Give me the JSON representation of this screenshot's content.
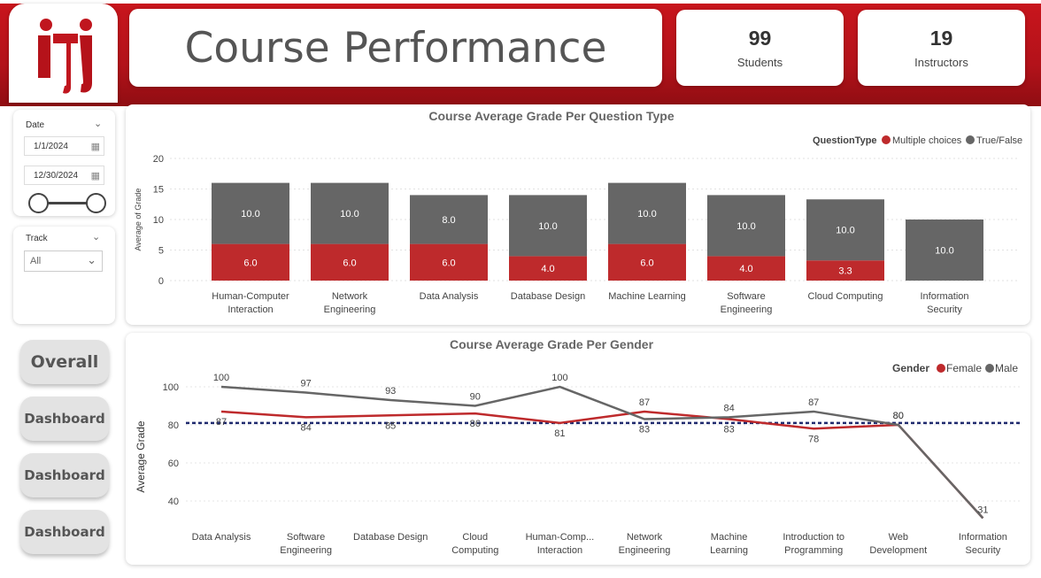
{
  "header": {
    "title": "Course Performance",
    "kpis": [
      {
        "value": "99",
        "label": "Students"
      },
      {
        "value": "19",
        "label": "Instructors"
      }
    ]
  },
  "filters": {
    "date_label": "Date",
    "start_date": "1/1/2024",
    "end_date": "12/30/2024",
    "track_label": "Track",
    "track_value": "All"
  },
  "nav": {
    "buttons": [
      "Overall",
      "Dashboard",
      "Dashboard",
      "Dashboard"
    ]
  },
  "colors": {
    "brand_red": "#c0161e",
    "bar_red": "#be2a2c",
    "bar_gray": "#666666",
    "avg_line": "#1f2a6e"
  },
  "chart_data": [
    {
      "type": "bar",
      "stacked": true,
      "title": "Course Average Grade Per Question Type",
      "ylabel": "Average of Grade",
      "xlabel": "",
      "ylim": [
        0,
        20
      ],
      "yticks": [
        0,
        5,
        10,
        15,
        20
      ],
      "legend_title": "QuestionType",
      "legend_position": "top-right",
      "categories": [
        "Human-Computer Interaction",
        "Network Engineering",
        "Data Analysis",
        "Database Design",
        "Machine Learning",
        "Software Engineering",
        "Cloud Computing",
        "Information Security"
      ],
      "series": [
        {
          "name": "Multiple choices",
          "color": "#be2a2c",
          "values": [
            6.0,
            6.0,
            6.0,
            4.0,
            6.0,
            4.0,
            3.3,
            0
          ],
          "labels": [
            "6.0",
            "6.0",
            "6.0",
            "4.0",
            "6.0",
            "4.0",
            "3.3",
            ""
          ]
        },
        {
          "name": "True/False",
          "color": "#666666",
          "values": [
            10.0,
            10.0,
            8.0,
            10.0,
            10.0,
            10.0,
            10.0,
            10.0
          ],
          "labels": [
            "10.0",
            "10.0",
            "8.0",
            "10.0",
            "10.0",
            "10.0",
            "10.0",
            "10.0"
          ]
        }
      ]
    },
    {
      "type": "line",
      "title": "Course Average Grade Per Gender",
      "ylabel": "Average Grade",
      "xlabel": "",
      "ylim": [
        30,
        105
      ],
      "yticks": [
        40,
        60,
        80,
        100
      ],
      "legend_title": "Gender",
      "legend_position": "top-right",
      "reference_line": 81,
      "categories": [
        "Data Analysis",
        "Software Engineering",
        "Database Design",
        "Cloud Computing",
        "Human-Comp... Interaction",
        "Network Engineering",
        "Machine Learning",
        "Introduction to Programming",
        "Web Development",
        "Information Security"
      ],
      "series": [
        {
          "name": "Female",
          "color": "#be2a2c",
          "values": [
            87,
            84,
            85,
            86,
            81,
            87,
            83,
            78,
            80,
            31
          ]
        },
        {
          "name": "Male",
          "color": "#666666",
          "values": [
            100,
            97,
            93,
            90,
            100,
            83,
            84,
            87,
            80,
            31
          ]
        }
      ],
      "point_labels": [
        {
          "i": 0,
          "v": 100
        },
        {
          "i": 0,
          "v": 87
        },
        {
          "i": 1,
          "v": 97
        },
        {
          "i": 1,
          "v": 84
        },
        {
          "i": 2,
          "v": 85
        },
        {
          "i": 2,
          "v": 93
        },
        {
          "i": 3,
          "v": 86
        },
        {
          "i": 3,
          "v": 90
        },
        {
          "i": 4,
          "v": 100
        },
        {
          "i": 4,
          "v": 81
        },
        {
          "i": 5,
          "v": 87
        },
        {
          "i": 5,
          "v": 83
        },
        {
          "i": 6,
          "v": 83
        },
        {
          "i": 6,
          "v": 84
        },
        {
          "i": 7,
          "v": 87
        },
        {
          "i": 7,
          "v": 78
        },
        {
          "i": 8,
          "v": 80
        },
        {
          "i": 8,
          "v": 80
        },
        {
          "i": 9,
          "v": 31
        }
      ]
    }
  ]
}
